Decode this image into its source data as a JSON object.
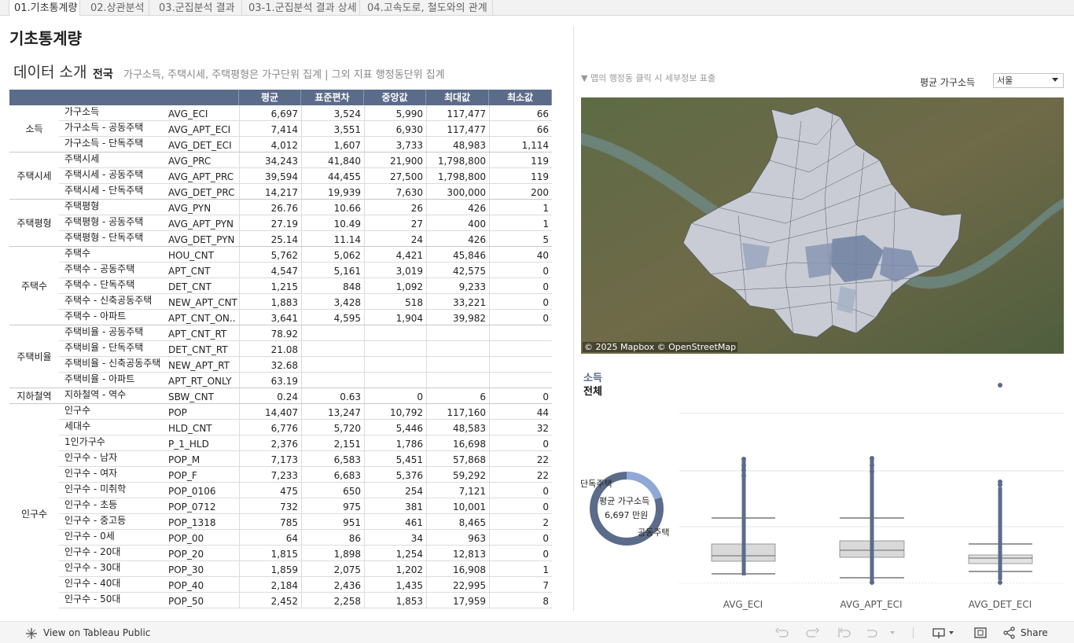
{
  "tabs": [
    {
      "label": "01.기초통계량",
      "active": true
    },
    {
      "label": "02.상관분석",
      "active": false
    },
    {
      "label": "03.군집분석 결과",
      "active": false
    },
    {
      "label": "03-1.군집분석 결과 상세",
      "active": false
    },
    {
      "label": "04.고속도로, 철도와의 관계",
      "active": false
    }
  ],
  "page_title": "기초통계량",
  "section": {
    "title": "데이터 소개",
    "scope": "전국",
    "note": "가구소득, 주택시세, 주택평형은 가구단위 집계 | 그외 지표 행정동단위 집계"
  },
  "table": {
    "headers": [
      "평균",
      "표준편차",
      "중앙값",
      "최대값",
      "최소값"
    ],
    "groups": [
      {
        "name": "소득",
        "rows": 3
      },
      {
        "name": "주택시세",
        "rows": 3
      },
      {
        "name": "주택평형",
        "rows": 3
      },
      {
        "name": "주택수",
        "rows": 5
      },
      {
        "name": "주택비율",
        "rows": 4
      },
      {
        "name": "지하철역",
        "rows": 1
      },
      {
        "name": "인구수",
        "rows": 14
      }
    ],
    "rows": [
      {
        "ko": "가구소득",
        "code": "AVG_ECI",
        "mean": "6,697",
        "std": "3,524",
        "median": "5,990",
        "max": "117,477",
        "min": "66"
      },
      {
        "ko": "가구소득 - 공동주택",
        "code": "AVG_APT_ECI",
        "mean": "7,414",
        "std": "3,551",
        "median": "6,930",
        "max": "117,477",
        "min": "66"
      },
      {
        "ko": "가구소득 - 단독주택",
        "code": "AVG_DET_ECI",
        "mean": "4,012",
        "std": "1,607",
        "median": "3,733",
        "max": "48,983",
        "min": "1,114"
      },
      {
        "ko": "주택시세",
        "code": "AVG_PRC",
        "mean": "34,243",
        "std": "41,840",
        "median": "21,900",
        "max": "1,798,800",
        "min": "119"
      },
      {
        "ko": "주택시세 - 공동주택",
        "code": "AVG_APT_PRC",
        "mean": "39,594",
        "std": "44,455",
        "median": "27,500",
        "max": "1,798,800",
        "min": "119"
      },
      {
        "ko": "주택시세 - 단독주택",
        "code": "AVG_DET_PRC",
        "mean": "14,217",
        "std": "19,939",
        "median": "7,630",
        "max": "300,000",
        "min": "200"
      },
      {
        "ko": "주택평형",
        "code": "AVG_PYN",
        "mean": "26.76",
        "std": "10.66",
        "median": "26",
        "max": "426",
        "min": "1"
      },
      {
        "ko": "주택평형 - 공동주택",
        "code": "AVG_APT_PYN",
        "mean": "27.19",
        "std": "10.49",
        "median": "27",
        "max": "400",
        "min": "1"
      },
      {
        "ko": "주택평형 - 단독주택",
        "code": "AVG_DET_PYN",
        "mean": "25.14",
        "std": "11.14",
        "median": "24",
        "max": "426",
        "min": "5"
      },
      {
        "ko": "주택수",
        "code": "HOU_CNT",
        "mean": "5,762",
        "std": "5,062",
        "median": "4,421",
        "max": "45,846",
        "min": "40"
      },
      {
        "ko": "주택수 - 공동주택",
        "code": "APT_CNT",
        "mean": "4,547",
        "std": "5,161",
        "median": "3,019",
        "max": "42,575",
        "min": "0"
      },
      {
        "ko": "주택수 - 단독주택",
        "code": "DET_CNT",
        "mean": "1,215",
        "std": "848",
        "median": "1,092",
        "max": "9,233",
        "min": "0"
      },
      {
        "ko": "주택수 - 신축공동주택",
        "code": "NEW_APT_CNT",
        "mean": "1,883",
        "std": "3,428",
        "median": "518",
        "max": "33,221",
        "min": "0"
      },
      {
        "ko": "주택수 - 아파트",
        "code": "APT_CNT_ON..",
        "mean": "3,641",
        "std": "4,595",
        "median": "1,904",
        "max": "39,982",
        "min": "0"
      },
      {
        "ko": "주택비율 - 공동주택",
        "code": "APT_CNT_RT",
        "mean": "78.92",
        "std": "",
        "median": "",
        "max": "",
        "min": ""
      },
      {
        "ko": "주택비율 - 단독주택",
        "code": "DET_CNT_RT",
        "mean": "21.08",
        "std": "",
        "median": "",
        "max": "",
        "min": ""
      },
      {
        "ko": "주택비율 - 신축공동주택",
        "code": "NEW_APT_RT",
        "mean": "32.68",
        "std": "",
        "median": "",
        "max": "",
        "min": ""
      },
      {
        "ko": "주택비율 - 아파트",
        "code": "APT_RT_ONLY",
        "mean": "63.19",
        "std": "",
        "median": "",
        "max": "",
        "min": ""
      },
      {
        "ko": "지하철역 - 역수",
        "code": "SBW_CNT",
        "mean": "0.24",
        "std": "0.63",
        "median": "0",
        "max": "6",
        "min": "0"
      },
      {
        "ko": "인구수",
        "code": "POP",
        "mean": "14,407",
        "std": "13,247",
        "median": "10,792",
        "max": "117,160",
        "min": "44"
      },
      {
        "ko": "세대수",
        "code": "HLD_CNT",
        "mean": "6,776",
        "std": "5,720",
        "median": "5,446",
        "max": "48,583",
        "min": "32"
      },
      {
        "ko": "1인가구수",
        "code": "P_1_HLD",
        "mean": "2,376",
        "std": "2,151",
        "median": "1,786",
        "max": "16,698",
        "min": "0"
      },
      {
        "ko": "인구수 - 남자",
        "code": "POP_M",
        "mean": "7,173",
        "std": "6,583",
        "median": "5,451",
        "max": "57,868",
        "min": "22"
      },
      {
        "ko": "인구수 - 여자",
        "code": "POP_F",
        "mean": "7,233",
        "std": "6,683",
        "median": "5,376",
        "max": "59,292",
        "min": "22"
      },
      {
        "ko": "인구수 - 미취학",
        "code": "POP_0106",
        "mean": "475",
        "std": "650",
        "median": "254",
        "max": "7,121",
        "min": "0"
      },
      {
        "ko": "인구수 - 초등",
        "code": "POP_0712",
        "mean": "732",
        "std": "975",
        "median": "381",
        "max": "10,001",
        "min": "0"
      },
      {
        "ko": "인구수 - 중고등",
        "code": "POP_1318",
        "mean": "785",
        "std": "951",
        "median": "461",
        "max": "8,465",
        "min": "2"
      },
      {
        "ko": "인구수 - 0세",
        "code": "POP_00",
        "mean": "64",
        "std": "86",
        "median": "34",
        "max": "963",
        "min": "0"
      },
      {
        "ko": "인구수 - 20대",
        "code": "POP_20",
        "mean": "1,815",
        "std": "1,898",
        "median": "1,254",
        "max": "12,813",
        "min": "0"
      },
      {
        "ko": "인구수 - 30대",
        "code": "POP_30",
        "mean": "1,859",
        "std": "2,075",
        "median": "1,202",
        "max": "16,908",
        "min": "1"
      },
      {
        "ko": "인구수 - 40대",
        "code": "POP_40",
        "mean": "2,184",
        "std": "2,436",
        "median": "1,435",
        "max": "22,995",
        "min": "7"
      },
      {
        "ko": "인구수 - 50대",
        "code": "POP_50",
        "mean": "2,452",
        "std": "2,258",
        "median": "1,853",
        "max": "17,959",
        "min": "8"
      }
    ]
  },
  "map": {
    "hint": "▼ 맵의 행정동 클릭 시 세부정보 표출",
    "filter_label": "평균 가구소득",
    "filter_value": "서울",
    "attribution": "© 2025 Mapbox  © OpenStreetMap"
  },
  "income_panel": {
    "title": "소득",
    "subtitle": "전체",
    "donut_center_label": "평균 가구소득",
    "donut_center_value": "6,697 만원",
    "donut_label_left": "단독주택",
    "donut_label_right": "공동주택",
    "donut_share_detached": 0.2,
    "colors": {
      "apartment": "#5b6b8a",
      "detached": "#8fa8d6",
      "box_fill": "#d9d9d9"
    }
  },
  "chart_data": {
    "type": "box",
    "categories": [
      "AVG_ECI",
      "AVG_APT_ECI",
      "AVG_DET_ECI"
    ]
  },
  "toolbar": {
    "view_on": "View on Tableau Public",
    "share": "Share"
  }
}
